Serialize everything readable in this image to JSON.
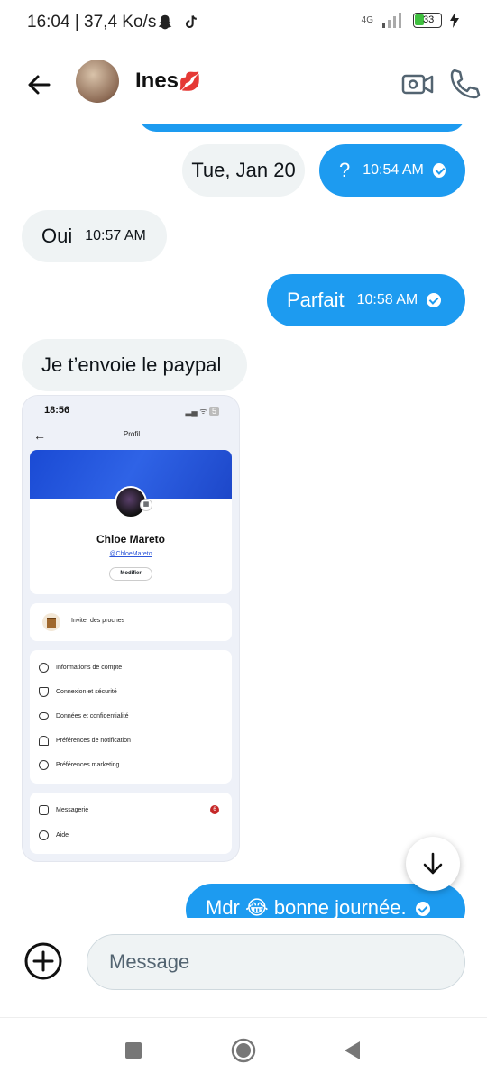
{
  "status_bar": {
    "time": "16:04",
    "network_speed": "37,4 Ko/s",
    "network_type": "4G",
    "battery": "33",
    "icons": [
      "snapchat-icon",
      "tiktok-icon",
      "signal-icon",
      "battery-icon",
      "charging-icon"
    ]
  },
  "header": {
    "contact_name": "Ines",
    "name_emoji": "💋",
    "back_icon": "arrow-left-icon",
    "video_icon": "video-camera-icon",
    "call_icon": "phone-icon"
  },
  "messages": [
    {
      "type": "incoming",
      "text": "Tue, Jan 20",
      "time": ""
    },
    {
      "type": "outgoing",
      "text": "?",
      "time": "10:54 AM",
      "read": true
    },
    {
      "type": "incoming",
      "text": "Oui",
      "time": "10:57 AM"
    },
    {
      "type": "outgoing",
      "text": "Parfait",
      "time": "10:58 AM",
      "read": true
    },
    {
      "type": "incoming",
      "text": "Je t’envoie le paypal",
      "time": ""
    },
    {
      "type": "outgoing",
      "text": "Mdr 😂 bonne journée.",
      "time": "",
      "read": true
    }
  ],
  "shared_screenshot": {
    "time": "18:56",
    "battery": "5",
    "page_title": "Profil",
    "profile_name": "Chloe Mareto",
    "handle": "@ChloeMareto",
    "edit_button": "Modifier",
    "invite": "Inviter des proches",
    "settings": [
      "Informations de compte",
      "Connexion et sécurité",
      "Données et confidentialité",
      "Préférences de notification",
      "Préférences marketing"
    ],
    "messaging": "Messagerie",
    "messaging_badge": "6",
    "help": "Aide"
  },
  "composer": {
    "placeholder": "Message",
    "add_icon": "plus-circle-icon"
  },
  "colors": {
    "outgoing_bubble": "#1d9bf0",
    "incoming_bubble": "#eff3f4",
    "banner_blue": "#2f63e6"
  }
}
